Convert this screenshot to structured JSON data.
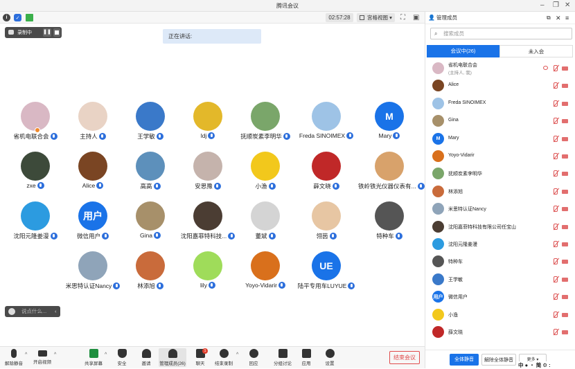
{
  "app": {
    "title": "腾讯会议",
    "timer": "02:57:28",
    "view_mode": "宫格视图",
    "speaking_label": "正在讲话:",
    "recording_label": "录制中",
    "chat_placeholder": "说点什么..."
  },
  "tiles": [
    {
      "name": "省机电联合会",
      "color": "#d9b8c4"
    },
    {
      "name": "主持人",
      "color": "#e9d3c5"
    },
    {
      "name": "王学敏",
      "color": "#3a79c9"
    },
    {
      "name": "ldj",
      "color": "#e3b82a"
    },
    {
      "name": "抚顺炭素李明华",
      "color": "#7aa66a"
    },
    {
      "name": "Freda SINOIMEX",
      "color": "#9ec3e6"
    },
    {
      "name": "Mary",
      "color": "#1a73e8",
      "letter": "M"
    },
    {
      "name": "zxe",
      "color": "#3d4a3a"
    },
    {
      "name": "Alice",
      "color": "#7a4523"
    },
    {
      "name": "高高",
      "color": "#5d90bb"
    },
    {
      "name": "安思豫",
      "color": "#c5b3ac"
    },
    {
      "name": "小渔",
      "color": "#f2c81c"
    },
    {
      "name": "薛文晓",
      "color": "#c02828"
    },
    {
      "name": "铁岭铁光仪器仪表有...",
      "color": "#d8a26b"
    },
    {
      "name": "沈阳元隆姜漫",
      "color": "#2c9be0"
    },
    {
      "name": "微信用户",
      "color": "#1a73e8",
      "letter": "用户"
    },
    {
      "name": "Gina",
      "color": "#a7906a"
    },
    {
      "name": "沈阳嘉菲特科技...",
      "color": "#4b3d33"
    },
    {
      "name": "董斌",
      "color": "#d4d4d4"
    },
    {
      "name": "翎茵",
      "color": "#e7c6a3"
    },
    {
      "name": "特种车",
      "color": "#555"
    },
    {
      "name": "米思特认证Nancy",
      "color": "#8fa4b9"
    },
    {
      "name": "林添旭",
      "color": "#c96b3b"
    },
    {
      "name": "lily",
      "color": "#9fdc5a"
    },
    {
      "name": "Yoyo-Vidarir",
      "color": "#d9701c"
    },
    {
      "name": "陆平专用车LUYUE",
      "color": "#1a73e8",
      "letter": "UE"
    }
  ],
  "bottom": {
    "mute": "解除静音",
    "video": "开启视频",
    "share": "共享屏幕",
    "security": "安全",
    "invite": "邀请",
    "members": "管理成员(26)",
    "chat": "聊天",
    "stop_record": "结束录制",
    "react": "回应",
    "breakout": "分组讨论",
    "apps": "应用",
    "settings": "设置",
    "end": "结束会议",
    "chat_badge": "1"
  },
  "panel": {
    "title": "管理成员",
    "search_placeholder": "搜索成员",
    "tab_in": "会议中(26)",
    "tab_out": "未入会",
    "members": [
      {
        "name": "省机电联合会",
        "sub": "(主持人, 我)",
        "color": "#d9b8c4"
      },
      {
        "name": "Alice",
        "color": "#7a4523"
      },
      {
        "name": "Freda SINOIMEX",
        "color": "#9ec3e6"
      },
      {
        "name": "Gina",
        "color": "#a7906a"
      },
      {
        "name": "Mary",
        "color": "#1a73e8",
        "letter": "M"
      },
      {
        "name": "Yoyo-Vidarir",
        "color": "#d9701c"
      },
      {
        "name": "抚顺炭素李明华",
        "color": "#7aa66a"
      },
      {
        "name": "林添旭",
        "color": "#c96b3b"
      },
      {
        "name": "米思特认证Nancy",
        "color": "#8fa4b9"
      },
      {
        "name": "沈阳嘉菲特科技有限公司任宝山",
        "color": "#4b3d33"
      },
      {
        "name": "沈阳元隆姜漫",
        "color": "#2c9be0"
      },
      {
        "name": "特种车",
        "color": "#555"
      },
      {
        "name": "王学敏",
        "color": "#3a79c9"
      },
      {
        "name": "微信用户",
        "color": "#1a73e8",
        "letter": "用户"
      },
      {
        "name": "小渔",
        "color": "#f2c81c"
      },
      {
        "name": "薛文晓",
        "color": "#c02828"
      }
    ],
    "mute_all": "全体静音",
    "unmute_all": "解除全体静音",
    "more": "更多",
    "ime": "中 ● ・ 简 ⚙ :"
  }
}
